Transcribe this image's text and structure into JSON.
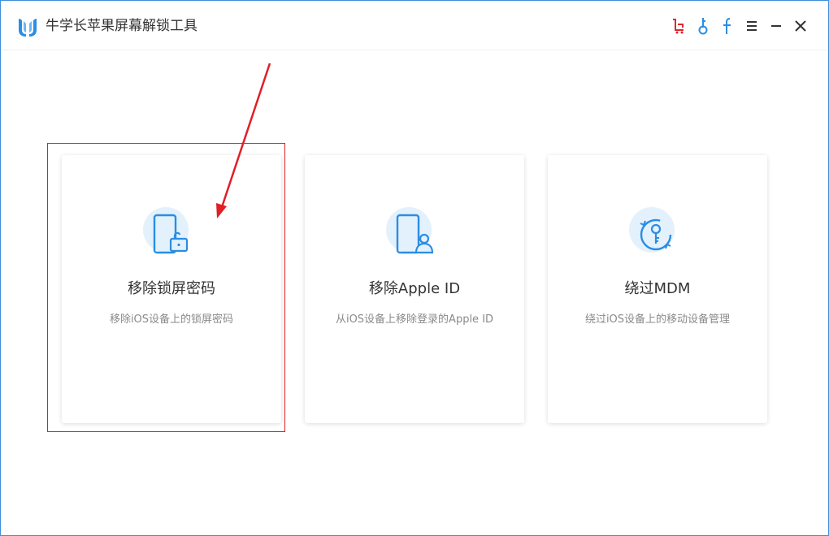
{
  "app": {
    "title": "牛学长苹果屏幕解锁工具",
    "logo_icon": "niuxuezhang-logo"
  },
  "titlebar": {
    "icons": [
      {
        "name": "cart-icon",
        "color": "#e0262d"
      },
      {
        "name": "key-icon",
        "color": "#2b8de3"
      },
      {
        "name": "facebook-icon",
        "color": "#2b8de3"
      },
      {
        "name": "menu-icon",
        "color": "#333333"
      },
      {
        "name": "minimize-icon",
        "color": "#333333"
      },
      {
        "name": "close-icon",
        "color": "#333333"
      }
    ]
  },
  "cards": [
    {
      "title": "移除锁屏密码",
      "description": "移除iOS设备上的锁屏密码",
      "icon": "phone-lock-icon",
      "highlighted": true
    },
    {
      "title": "移除Apple ID",
      "description": "从iOS设备上移除登录的Apple ID",
      "icon": "phone-user-icon",
      "highlighted": false
    },
    {
      "title": "绕过MDM",
      "description": "绕过iOS设备上的移动设备管理",
      "icon": "bypass-key-icon",
      "highlighted": false
    }
  ],
  "colors": {
    "accent": "#2b8de3",
    "icon_bg": "#e3f1fc",
    "annotation": "#e01f26",
    "window_border": "#3d8fd8"
  },
  "annotations": {
    "arrow_icon": "red-arrow-annotation",
    "box": "red-highlight-box"
  }
}
